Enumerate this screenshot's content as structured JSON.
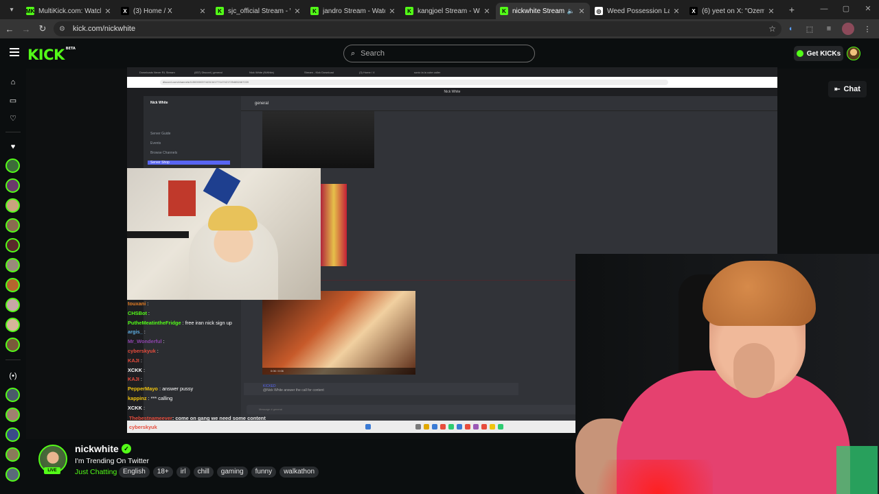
{
  "browser": {
    "tabs": [
      {
        "title": "MultiKick.com: Watch Mu",
        "fav": "MK",
        "color": "#53fc18",
        "active": false
      },
      {
        "title": "(3) Home / X",
        "fav": "X",
        "color": "#000000",
        "active": false
      },
      {
        "title": "sjc_official Stream - Watc",
        "fav": "K",
        "color": "#53fc18",
        "active": false
      },
      {
        "title": "jandro Stream - Watch Li",
        "fav": "K",
        "color": "#53fc18",
        "active": false
      },
      {
        "title": "kangjoel Stream - Watch",
        "fav": "K",
        "color": "#53fc18",
        "active": false
      },
      {
        "title": "nickwhite Stream - W",
        "fav": "K",
        "color": "#53fc18",
        "active": true
      },
      {
        "title": "Weed Possession Laws Pe",
        "fav": "◎",
        "color": "#ffffff",
        "active": false
      },
      {
        "title": "(6) yeet on X: \"Ozemi spc",
        "fav": "X",
        "color": "#000000",
        "active": false
      }
    ],
    "url": "kick.com/nickwhite"
  },
  "header": {
    "logo": "KICK",
    "logo_badge": "BETA",
    "search_placeholder": "Search",
    "get_kicks": "Get KICKs"
  },
  "chat_button": "Chat",
  "stream_overlay": {
    "tabs": [
      "Downloads Never RL Stream",
      "(837) Discord | general",
      "Nick White (NWhite)",
      "Stream - Kick Download",
      "(3) Home / X",
      "sonic la la cube caller"
    ],
    "url": "discord.com/channels/1150000037443134177/1474217254652467220",
    "server": "Nick White",
    "channel": "general",
    "channels": [
      "Server Guide",
      "Events",
      "Browse Channels",
      "Server Shop"
    ],
    "message_author": "KICKED",
    "message": "@Nick White answer the call for content",
    "input_placeholder": "Message # general",
    "video_time": "0:06 / 0:06"
  },
  "stream_chat": [
    {
      "user": "touxani",
      "color": "#e67e22",
      "msg": ""
    },
    {
      "user": "CHSBot",
      "color": "#53fc18",
      "msg": ""
    },
    {
      "user": "PutheMeatintheFridge",
      "color": "#53fc18",
      "msg": "free iran nick sign up"
    },
    {
      "user": "argis_",
      "color": "#5dade2",
      "msg": ""
    },
    {
      "user": "Mr_Wonderful",
      "color": "#8e44ad",
      "msg": ""
    },
    {
      "user": "cyberskyuk",
      "color": "#e74c3c",
      "msg": ""
    },
    {
      "user": "KAJI",
      "color": "#e74c3c",
      "msg": ""
    },
    {
      "user": "XCKK",
      "color": "#ffffff",
      "msg": ""
    },
    {
      "user": "KAJI",
      "color": "#e74c3c",
      "msg": ""
    },
    {
      "user": "PepperMayo",
      "color": "#f1c40f",
      "msg": "answer pussy"
    },
    {
      "user": "kappinz",
      "color": "#f1c40f",
      "msg": "*** calling"
    },
    {
      "user": "XCKK",
      "color": "#ffffff",
      "msg": ""
    }
  ],
  "chat_extra": [
    {
      "user": "Thebestnameever",
      "color": "#e74c3c",
      "msg": "come on gang we need some content"
    },
    {
      "user": "cyberskyuk",
      "color": "#e74c3c",
      "msg": ""
    }
  ],
  "channel": {
    "name": "nickwhite",
    "title": "I'm Trending On Twitter",
    "category": "Just Chatting",
    "live": "LIVE",
    "tags": [
      "English",
      "18+",
      "irl",
      "chill",
      "gaming",
      "funny",
      "walkathon"
    ]
  },
  "colors": {
    "accent": "#53fc18",
    "bg": "#0b0e0f"
  }
}
